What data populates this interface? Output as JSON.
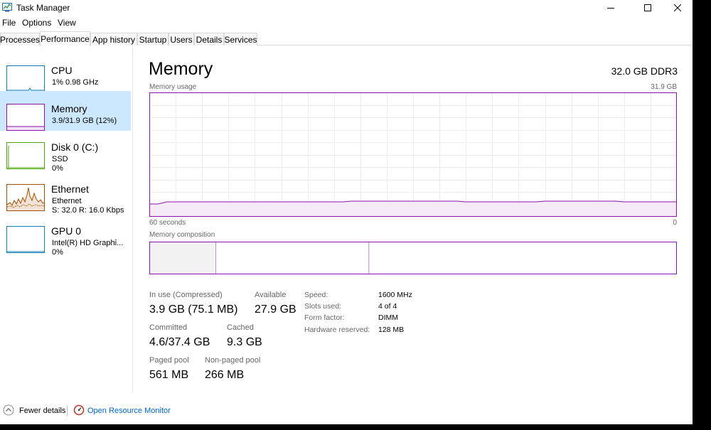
{
  "window": {
    "title": "Task Manager"
  },
  "menu": [
    "File",
    "Options",
    "View"
  ],
  "tabs": [
    "Processes",
    "Performance",
    "App history",
    "Startup",
    "Users",
    "Details",
    "Services"
  ],
  "sidebar": [
    {
      "name": "CPU",
      "line1": "1%  0.98 GHz",
      "color": "#117dbb"
    },
    {
      "name": "Memory",
      "line1": "3.9/31.9 GB (12%)",
      "color": "#8b12ae"
    },
    {
      "name": "Disk 0 (C:)",
      "line1": "SSD",
      "line2": "0%",
      "color": "#4da60c"
    },
    {
      "name": "Ethernet",
      "line1": "Ethernet",
      "line2": "S: 32.0  R: 16.0 Kbps",
      "color": "#a74f01"
    },
    {
      "name": "GPU 0",
      "line1": "Intel(R) HD Graphi...",
      "line2": "0%",
      "color": "#117dbb"
    }
  ],
  "main": {
    "title": "Memory",
    "spec": "32.0 GB DDR3",
    "usage_label": "Memory usage",
    "usage_max": "31.9 GB",
    "time_left": "60 seconds",
    "time_right": "0",
    "composition_label": "Memory composition",
    "in_use_label": "In use (Compressed)",
    "in_use_value": "3.9 GB (75.1 MB)",
    "available_label": "Available",
    "available_value": "27.9 GB",
    "committed_label": "Committed",
    "committed_value": "4.6/37.4 GB",
    "cached_label": "Cached",
    "cached_value": "9.3 GB",
    "paged_label": "Paged pool",
    "paged_value": "561 MB",
    "nonpaged_label": "Non-paged pool",
    "nonpaged_value": "266 MB",
    "details": [
      {
        "key": "Speed:",
        "value": "1600 MHz"
      },
      {
        "key": "Slots used:",
        "value": "4 of 4"
      },
      {
        "key": "Form factor:",
        "value": "DIMM"
      },
      {
        "key": "Hardware reserved:",
        "value": "128 MB"
      }
    ],
    "usage_fraction": 0.12,
    "composition_fractions": {
      "in_use": 0.122,
      "modified": 0.003,
      "standby": 0.291,
      "free": 0.584
    }
  },
  "footer": {
    "fewer_details": "Fewer details",
    "open_resource_monitor": "Open Resource Monitor"
  },
  "colors": {
    "memory_accent": "#8b12ae",
    "selection": "#cce8ff",
    "link": "#0066cc"
  }
}
